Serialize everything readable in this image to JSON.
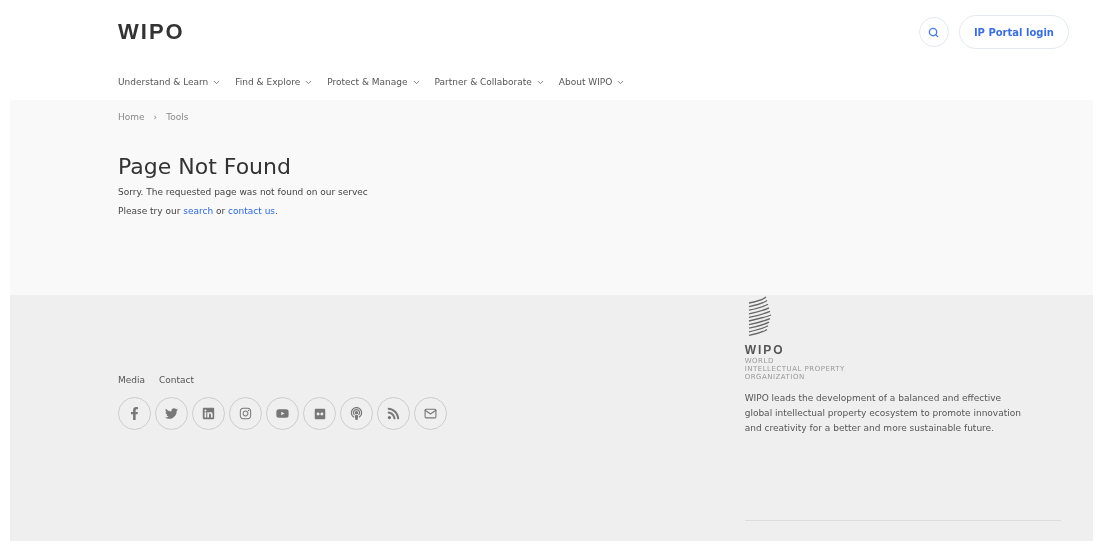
{
  "header": {
    "logo": "WIPO",
    "login_button": "IP Portal login"
  },
  "nav": [
    {
      "label": "Understand & Learn"
    },
    {
      "label": "Find & Explore"
    },
    {
      "label": "Protect & Manage"
    },
    {
      "label": "Partner & Collaborate"
    },
    {
      "label": "About WIPO"
    }
  ],
  "breadcrumb": [
    {
      "label": "Home"
    },
    {
      "label": "Tools"
    }
  ],
  "breadcrumb_separator": "›",
  "content": {
    "title": "Page Not Found",
    "message": "Sorry. The requested page was not found on our servec",
    "help": {
      "before": "Please try our ",
      "link_1": "search",
      "between": " or ",
      "link_2": "contact us",
      "after": "."
    }
  },
  "footer": {
    "links": [
      "Media",
      "Contact"
    ],
    "social": [
      {
        "kind": "facebook"
      },
      {
        "kind": "twitter"
      },
      {
        "kind": "linkedin"
      },
      {
        "kind": "instagram"
      },
      {
        "kind": "youtube"
      },
      {
        "kind": "flickr"
      },
      {
        "kind": "podcast"
      },
      {
        "kind": "rss"
      },
      {
        "kind": "email"
      }
    ],
    "logo": {
      "name": "WIPO",
      "lines": [
        "WORLD",
        "INTELLECTUAL PROPERTY",
        "ORGANIZATION"
      ]
    },
    "about": "WIPO leads the development of a balanced and effective global intellectual property ecosystem to promote innovation and creativity for a better and more sustainable future."
  }
}
